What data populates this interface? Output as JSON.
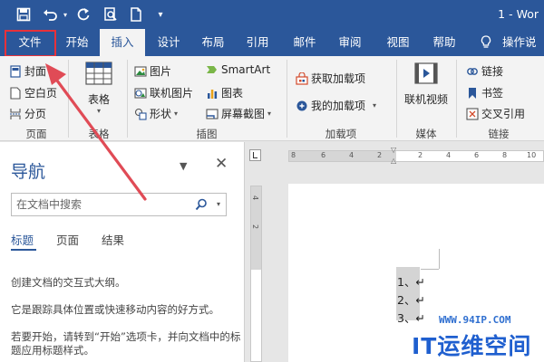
{
  "titlebar": {
    "title_partial": "1  -  Wor",
    "icons": [
      "save-icon",
      "undo-icon",
      "redo-icon",
      "print-preview-icon",
      "new-document-icon",
      "customize-qat-icon"
    ]
  },
  "tabs": [
    {
      "label": "文件",
      "active": false
    },
    {
      "label": "开始",
      "active": false
    },
    {
      "label": "插入",
      "active": true
    },
    {
      "label": "设计",
      "active": false
    },
    {
      "label": "布局",
      "active": false
    },
    {
      "label": "引用",
      "active": false
    },
    {
      "label": "邮件",
      "active": false
    },
    {
      "label": "审阅",
      "active": false
    },
    {
      "label": "视图",
      "active": false
    },
    {
      "label": "帮助",
      "active": false
    }
  ],
  "tell_me": "操作说",
  "ribbon": {
    "pages": {
      "cover": "封面",
      "blank": "空白页",
      "break": "分页",
      "label": "页面"
    },
    "tables": {
      "table": "表格",
      "label": "表格"
    },
    "illustrations": {
      "picture": "图片",
      "online_picture": "联机图片",
      "shapes": "形状",
      "smartart": "SmartArt",
      "chart": "图表",
      "screenshot": "屏幕截图",
      "label": "插图"
    },
    "addins": {
      "get": "获取加载项",
      "mine": "我的加载项",
      "label": "加载项"
    },
    "media": {
      "online_video": "联机视频",
      "label": "媒体"
    },
    "links": {
      "link": "链接",
      "bookmark": "书签",
      "cross_ref": "交叉引用",
      "label": "链接"
    }
  },
  "nav": {
    "title": "导航",
    "search_placeholder": "在文档中搜索",
    "tabs": [
      "标题",
      "页面",
      "结果"
    ],
    "text1": "创建文档的交互式大纲。",
    "text2": "它是跟踪具体位置或快速移动内容的好方式。",
    "text3": "若要开始，请转到“开始”选项卡，并向文档中的标题应用标题样式。"
  },
  "ruler": {
    "h_ticks": [
      "8",
      "6",
      "4",
      "2",
      "2",
      "4",
      "6",
      "8",
      "10"
    ],
    "v_ticks": [
      "4",
      "2"
    ]
  },
  "document": {
    "lines": [
      "1、↵",
      "2、↵",
      "3、↵"
    ]
  },
  "watermark": {
    "url": "WWW.94IP.COM",
    "text": "IT运维空间"
  },
  "colors": {
    "accent": "#2b579a",
    "highlight": "#e8313a"
  }
}
